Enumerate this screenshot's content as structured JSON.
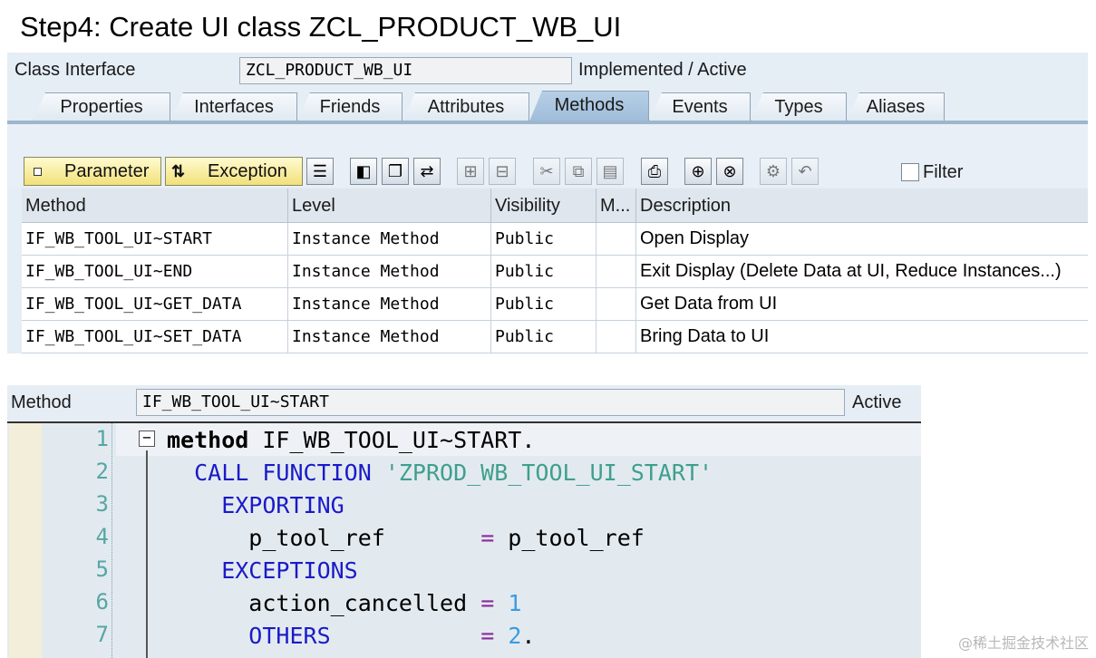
{
  "heading": "Step4: Create UI class ZCL_PRODUCT_WB_UI",
  "class_header": {
    "label": "Class Interface",
    "value": "ZCL_PRODUCT_WB_UI",
    "status": "Implemented / Active"
  },
  "tabs": [
    {
      "label": "Properties",
      "active": false
    },
    {
      "label": "Interfaces",
      "active": false
    },
    {
      "label": "Friends",
      "active": false
    },
    {
      "label": "Attributes",
      "active": false
    },
    {
      "label": "Methods",
      "active": true
    },
    {
      "label": "Events",
      "active": false
    },
    {
      "label": "Types",
      "active": false
    },
    {
      "label": "Aliases",
      "active": false
    }
  ],
  "toolbar": {
    "parameter_label": "Parameter",
    "exception_label": "Exception",
    "filter_label": "Filter",
    "icons": [
      "details-icon",
      "display-icon",
      "copy-object-icon",
      "navigate-icon",
      "insert-row-icon",
      "delete-row-icon",
      "cut-icon",
      "copy-icon",
      "paste-icon",
      "print-icon",
      "find-icon",
      "find-next-icon",
      "settings-icon",
      "undo-icon"
    ]
  },
  "methods_table": {
    "columns": [
      "Method",
      "Level",
      "Visibility",
      "M...",
      "Description"
    ],
    "rows": [
      {
        "method": "IF_WB_TOOL_UI~START",
        "level": "Instance Method",
        "visibility": "Public",
        "m": "",
        "description": "Open Display"
      },
      {
        "method": "IF_WB_TOOL_UI~END",
        "level": "Instance Method",
        "visibility": "Public",
        "m": "",
        "description": "Exit Display (Delete Data at UI, Reduce Instances...)"
      },
      {
        "method": "IF_WB_TOOL_UI~GET_DATA",
        "level": "Instance Method",
        "visibility": "Public",
        "m": "",
        "description": "Get Data from UI"
      },
      {
        "method": "IF_WB_TOOL_UI~SET_DATA",
        "level": "Instance Method",
        "visibility": "Public",
        "m": "",
        "description": "Bring Data to UI"
      }
    ]
  },
  "method_editor": {
    "label": "Method",
    "value": "IF_WB_TOOL_UI~START",
    "status": "Active",
    "lines": [
      {
        "n": "1",
        "tokens": [
          {
            "t": "method",
            "c": "kw-bold"
          },
          {
            "t": " IF_WB_TOOL_UI~START.",
            "c": "txt"
          }
        ]
      },
      {
        "n": "2",
        "tokens": [
          {
            "t": "  CALL FUNCTION ",
            "c": "kw"
          },
          {
            "t": "'ZPROD_WB_TOOL_UI_START'",
            "c": "str"
          }
        ]
      },
      {
        "n": "3",
        "tokens": [
          {
            "t": "    EXPORTING",
            "c": "kw"
          }
        ]
      },
      {
        "n": "4",
        "tokens": [
          {
            "t": "      p_tool_ref       ",
            "c": "txt"
          },
          {
            "t": "=",
            "c": "op"
          },
          {
            "t": " p_tool_ref",
            "c": "txt"
          }
        ]
      },
      {
        "n": "5",
        "tokens": [
          {
            "t": "    EXCEPTIONS",
            "c": "kw"
          }
        ]
      },
      {
        "n": "6",
        "tokens": [
          {
            "t": "      action_cancelled ",
            "c": "txt"
          },
          {
            "t": "=",
            "c": "op"
          },
          {
            "t": " ",
            "c": "txt"
          },
          {
            "t": "1",
            "c": "num"
          }
        ]
      },
      {
        "n": "7",
        "tokens": [
          {
            "t": "      OTHERS           ",
            "c": "kw"
          },
          {
            "t": "=",
            "c": "op"
          },
          {
            "t": " ",
            "c": "txt"
          },
          {
            "t": "2",
            "c": "num"
          },
          {
            "t": ".",
            "c": "txt"
          }
        ]
      }
    ]
  },
  "watermark": "@稀土掘金技术社区"
}
